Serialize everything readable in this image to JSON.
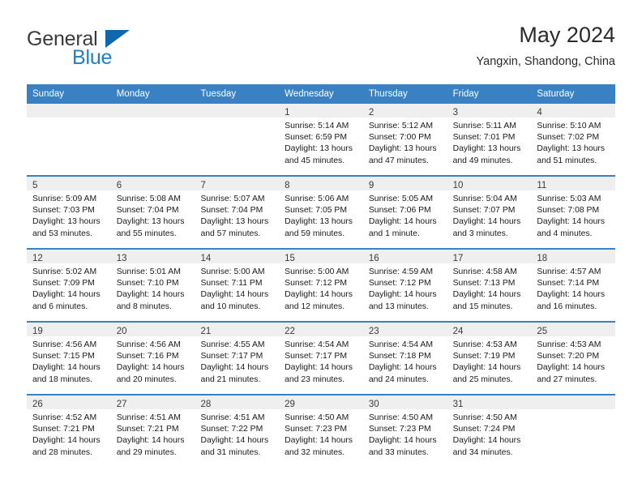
{
  "brand": {
    "line1": "General",
    "line2": "Blue",
    "triangle_icon": "triangle-icon",
    "colors": {
      "general": "#3b3b3b",
      "blue": "#1f7fc4",
      "triangle": "#1167ab"
    }
  },
  "header": {
    "title": "May 2024",
    "subtitle": "Yangxin, Shandong, China"
  },
  "theme": {
    "header_blue": "#3a81c3",
    "daynum_strip": "#efefef",
    "cell_background": "#ffffff",
    "text": "#1a1a1a"
  },
  "weekdays": [
    {
      "label": "Sunday"
    },
    {
      "label": "Monday"
    },
    {
      "label": "Tuesday"
    },
    {
      "label": "Wednesday"
    },
    {
      "label": "Thursday"
    },
    {
      "label": "Friday"
    },
    {
      "label": "Saturday"
    }
  ],
  "weeks": [
    [
      {
        "day": "",
        "empty": true,
        "sunrise": "",
        "sunset": "",
        "daylight_line1": "",
        "daylight_line2": ""
      },
      {
        "day": "",
        "empty": true,
        "sunrise": "",
        "sunset": "",
        "daylight_line1": "",
        "daylight_line2": ""
      },
      {
        "day": "",
        "empty": true,
        "sunrise": "",
        "sunset": "",
        "daylight_line1": "",
        "daylight_line2": ""
      },
      {
        "day": "1",
        "empty": false,
        "sunrise": "Sunrise: 5:14 AM",
        "sunset": "Sunset: 6:59 PM",
        "daylight_line1": "Daylight: 13 hours",
        "daylight_line2": "and 45 minutes."
      },
      {
        "day": "2",
        "empty": false,
        "sunrise": "Sunrise: 5:12 AM",
        "sunset": "Sunset: 7:00 PM",
        "daylight_line1": "Daylight: 13 hours",
        "daylight_line2": "and 47 minutes."
      },
      {
        "day": "3",
        "empty": false,
        "sunrise": "Sunrise: 5:11 AM",
        "sunset": "Sunset: 7:01 PM",
        "daylight_line1": "Daylight: 13 hours",
        "daylight_line2": "and 49 minutes."
      },
      {
        "day": "4",
        "empty": false,
        "sunrise": "Sunrise: 5:10 AM",
        "sunset": "Sunset: 7:02 PM",
        "daylight_line1": "Daylight: 13 hours",
        "daylight_line2": "and 51 minutes."
      }
    ],
    [
      {
        "day": "5",
        "empty": false,
        "sunrise": "Sunrise: 5:09 AM",
        "sunset": "Sunset: 7:03 PM",
        "daylight_line1": "Daylight: 13 hours",
        "daylight_line2": "and 53 minutes."
      },
      {
        "day": "6",
        "empty": false,
        "sunrise": "Sunrise: 5:08 AM",
        "sunset": "Sunset: 7:04 PM",
        "daylight_line1": "Daylight: 13 hours",
        "daylight_line2": "and 55 minutes."
      },
      {
        "day": "7",
        "empty": false,
        "sunrise": "Sunrise: 5:07 AM",
        "sunset": "Sunset: 7:04 PM",
        "daylight_line1": "Daylight: 13 hours",
        "daylight_line2": "and 57 minutes."
      },
      {
        "day": "8",
        "empty": false,
        "sunrise": "Sunrise: 5:06 AM",
        "sunset": "Sunset: 7:05 PM",
        "daylight_line1": "Daylight: 13 hours",
        "daylight_line2": "and 59 minutes."
      },
      {
        "day": "9",
        "empty": false,
        "sunrise": "Sunrise: 5:05 AM",
        "sunset": "Sunset: 7:06 PM",
        "daylight_line1": "Daylight: 14 hours",
        "daylight_line2": "and 1 minute."
      },
      {
        "day": "10",
        "empty": false,
        "sunrise": "Sunrise: 5:04 AM",
        "sunset": "Sunset: 7:07 PM",
        "daylight_line1": "Daylight: 14 hours",
        "daylight_line2": "and 3 minutes."
      },
      {
        "day": "11",
        "empty": false,
        "sunrise": "Sunrise: 5:03 AM",
        "sunset": "Sunset: 7:08 PM",
        "daylight_line1": "Daylight: 14 hours",
        "daylight_line2": "and 4 minutes."
      }
    ],
    [
      {
        "day": "12",
        "empty": false,
        "sunrise": "Sunrise: 5:02 AM",
        "sunset": "Sunset: 7:09 PM",
        "daylight_line1": "Daylight: 14 hours",
        "daylight_line2": "and 6 minutes."
      },
      {
        "day": "13",
        "empty": false,
        "sunrise": "Sunrise: 5:01 AM",
        "sunset": "Sunset: 7:10 PM",
        "daylight_line1": "Daylight: 14 hours",
        "daylight_line2": "and 8 minutes."
      },
      {
        "day": "14",
        "empty": false,
        "sunrise": "Sunrise: 5:00 AM",
        "sunset": "Sunset: 7:11 PM",
        "daylight_line1": "Daylight: 14 hours",
        "daylight_line2": "and 10 minutes."
      },
      {
        "day": "15",
        "empty": false,
        "sunrise": "Sunrise: 5:00 AM",
        "sunset": "Sunset: 7:12 PM",
        "daylight_line1": "Daylight: 14 hours",
        "daylight_line2": "and 12 minutes."
      },
      {
        "day": "16",
        "empty": false,
        "sunrise": "Sunrise: 4:59 AM",
        "sunset": "Sunset: 7:12 PM",
        "daylight_line1": "Daylight: 14 hours",
        "daylight_line2": "and 13 minutes."
      },
      {
        "day": "17",
        "empty": false,
        "sunrise": "Sunrise: 4:58 AM",
        "sunset": "Sunset: 7:13 PM",
        "daylight_line1": "Daylight: 14 hours",
        "daylight_line2": "and 15 minutes."
      },
      {
        "day": "18",
        "empty": false,
        "sunrise": "Sunrise: 4:57 AM",
        "sunset": "Sunset: 7:14 PM",
        "daylight_line1": "Daylight: 14 hours",
        "daylight_line2": "and 16 minutes."
      }
    ],
    [
      {
        "day": "19",
        "empty": false,
        "sunrise": "Sunrise: 4:56 AM",
        "sunset": "Sunset: 7:15 PM",
        "daylight_line1": "Daylight: 14 hours",
        "daylight_line2": "and 18 minutes."
      },
      {
        "day": "20",
        "empty": false,
        "sunrise": "Sunrise: 4:56 AM",
        "sunset": "Sunset: 7:16 PM",
        "daylight_line1": "Daylight: 14 hours",
        "daylight_line2": "and 20 minutes."
      },
      {
        "day": "21",
        "empty": false,
        "sunrise": "Sunrise: 4:55 AM",
        "sunset": "Sunset: 7:17 PM",
        "daylight_line1": "Daylight: 14 hours",
        "daylight_line2": "and 21 minutes."
      },
      {
        "day": "22",
        "empty": false,
        "sunrise": "Sunrise: 4:54 AM",
        "sunset": "Sunset: 7:17 PM",
        "daylight_line1": "Daylight: 14 hours",
        "daylight_line2": "and 23 minutes."
      },
      {
        "day": "23",
        "empty": false,
        "sunrise": "Sunrise: 4:54 AM",
        "sunset": "Sunset: 7:18 PM",
        "daylight_line1": "Daylight: 14 hours",
        "daylight_line2": "and 24 minutes."
      },
      {
        "day": "24",
        "empty": false,
        "sunrise": "Sunrise: 4:53 AM",
        "sunset": "Sunset: 7:19 PM",
        "daylight_line1": "Daylight: 14 hours",
        "daylight_line2": "and 25 minutes."
      },
      {
        "day": "25",
        "empty": false,
        "sunrise": "Sunrise: 4:53 AM",
        "sunset": "Sunset: 7:20 PM",
        "daylight_line1": "Daylight: 14 hours",
        "daylight_line2": "and 27 minutes."
      }
    ],
    [
      {
        "day": "26",
        "empty": false,
        "sunrise": "Sunrise: 4:52 AM",
        "sunset": "Sunset: 7:21 PM",
        "daylight_line1": "Daylight: 14 hours",
        "daylight_line2": "and 28 minutes."
      },
      {
        "day": "27",
        "empty": false,
        "sunrise": "Sunrise: 4:51 AM",
        "sunset": "Sunset: 7:21 PM",
        "daylight_line1": "Daylight: 14 hours",
        "daylight_line2": "and 29 minutes."
      },
      {
        "day": "28",
        "empty": false,
        "sunrise": "Sunrise: 4:51 AM",
        "sunset": "Sunset: 7:22 PM",
        "daylight_line1": "Daylight: 14 hours",
        "daylight_line2": "and 31 minutes."
      },
      {
        "day": "29",
        "empty": false,
        "sunrise": "Sunrise: 4:50 AM",
        "sunset": "Sunset: 7:23 PM",
        "daylight_line1": "Daylight: 14 hours",
        "daylight_line2": "and 32 minutes."
      },
      {
        "day": "30",
        "empty": false,
        "sunrise": "Sunrise: 4:50 AM",
        "sunset": "Sunset: 7:23 PM",
        "daylight_line1": "Daylight: 14 hours",
        "daylight_line2": "and 33 minutes."
      },
      {
        "day": "31",
        "empty": false,
        "sunrise": "Sunrise: 4:50 AM",
        "sunset": "Sunset: 7:24 PM",
        "daylight_line1": "Daylight: 14 hours",
        "daylight_line2": "and 34 minutes."
      },
      {
        "day": "",
        "empty": true,
        "sunrise": "",
        "sunset": "",
        "daylight_line1": "",
        "daylight_line2": ""
      }
    ]
  ]
}
